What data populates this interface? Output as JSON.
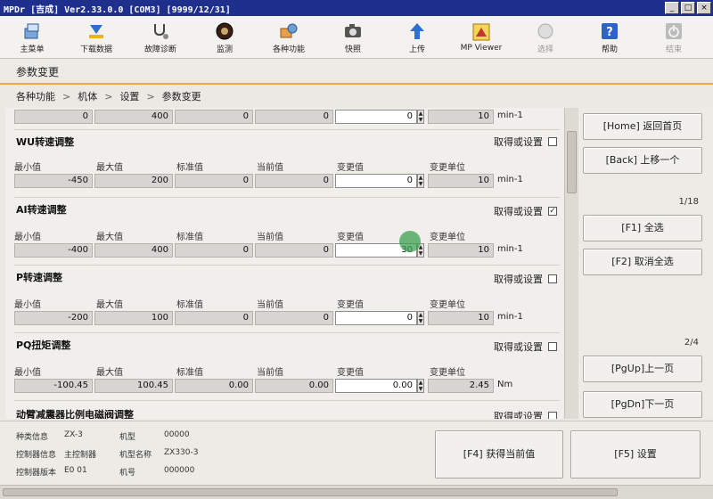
{
  "window": {
    "title": "MPDr [吉成] Ver2.33.0.0 [COM3] [9999/12/31]",
    "buttons": [
      "_",
      "□",
      "×"
    ]
  },
  "toolbar": [
    {
      "label": "主菜单",
      "icon": "main-menu-icon",
      "enabled": true
    },
    {
      "label": "下载数据",
      "icon": "download-icon",
      "enabled": true
    },
    {
      "label": "故障诊断",
      "icon": "stethoscope-icon",
      "enabled": true
    },
    {
      "label": "监测",
      "icon": "monitor-icon",
      "enabled": true
    },
    {
      "label": "各种功能",
      "icon": "functions-icon",
      "enabled": true
    },
    {
      "label": "快照",
      "icon": "camera-icon",
      "enabled": true
    },
    {
      "label": "上传",
      "icon": "upload-icon",
      "enabled": true
    },
    {
      "label": "MP Viewer",
      "icon": "mp-viewer-icon",
      "enabled": true
    },
    {
      "label": "选择",
      "icon": "select-icon",
      "enabled": false
    },
    {
      "label": "帮助",
      "icon": "help-icon",
      "enabled": true
    },
    {
      "label": "结束",
      "icon": "power-icon",
      "enabled": false
    }
  ],
  "page_title": "参数变更",
  "breadcrumb": [
    "各种功能",
    "机体",
    "设置",
    "参数变更"
  ],
  "column_labels": {
    "min": "最小值",
    "max": "最大值",
    "std": "标准值",
    "current": "当前值",
    "change": "变更值",
    "unit": "变更单位"
  },
  "acquire_label": "取得或设置",
  "partial_row": {
    "min": "0",
    "max": "400",
    "std": "0",
    "current": "0",
    "change": "0",
    "step": "10",
    "unit": "min-1"
  },
  "sections": [
    {
      "title": "WU转速调整",
      "checked": false,
      "min": "-450",
      "max": "200",
      "std": "0",
      "current": "0",
      "change": "0",
      "step": "10",
      "unit": "min-1"
    },
    {
      "title": "AI转速调整",
      "checked": true,
      "min": "-400",
      "max": "400",
      "std": "0",
      "current": "0",
      "change": "30",
      "step": "10",
      "unit": "min-1"
    },
    {
      "title": "P转速调整",
      "checked": false,
      "min": "-200",
      "max": "100",
      "std": "0",
      "current": "0",
      "change": "0",
      "step": "10",
      "unit": "min-1"
    },
    {
      "title": "PQ扭矩调整",
      "checked": false,
      "min": "-100.45",
      "max": "100.45",
      "std": "0.00",
      "current": "0.00",
      "change": "0.00",
      "step": "2.45",
      "unit": "Nm"
    }
  ],
  "last_section": {
    "title": "动臂减震器比例电磁阀调整",
    "checked": false
  },
  "right_panel": {
    "home": "[Home] 返回首页",
    "back": "[Back] 上移一个",
    "page_a": "1/18",
    "f1": "[F1] 全选",
    "f2": "[F2] 取消全选",
    "page_b": "2/4",
    "pgup": "[PgUp]上一页",
    "pgdn": "[PgDn]下一页"
  },
  "info": {
    "kind_label": "种类信息",
    "kind_value": "ZX-3",
    "model_label": "机型",
    "model_value": "00000",
    "ctrl_label": "控制器信息",
    "ctrl_value": "主控制器",
    "model_name_label": "机型名称",
    "model_name_value": "ZX330-3",
    "ver_label": "控制器版本",
    "ver_value": "E0 01",
    "serial_label": "机号",
    "serial_value": "000000"
  },
  "bottom_buttons": {
    "f4": "[F4] 获得当前值",
    "f5": "[F5] 设置"
  }
}
